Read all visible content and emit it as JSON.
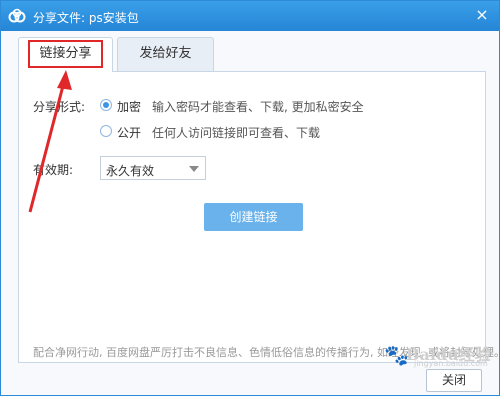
{
  "window": {
    "title": "分享文件: ps安装包",
    "close_glyph": "×"
  },
  "tabs": [
    {
      "label": "链接分享",
      "active": true
    },
    {
      "label": "发给好友",
      "active": false
    }
  ],
  "share_mode": {
    "label": "分享形式:",
    "options": [
      {
        "label": "加密",
        "hint": "输入密码才能查看、下载, 更加私密安全",
        "checked": true
      },
      {
        "label": "公开",
        "hint": "任何人访问链接即可查看、下载",
        "checked": false
      }
    ]
  },
  "validity": {
    "label": "有效期:",
    "selected": "永久有效"
  },
  "create_button": "创建链接",
  "footer_note": "配合净网行动, 百度网盘严厉打击不良信息、色情低俗信息的传播行为, 如经发现, 或将封号处理。",
  "close_button": "关闭",
  "watermark": {
    "text": "Baidu经验",
    "sub": "jingyan.baidu.com"
  },
  "colors": {
    "titlebar": "#2585d6",
    "accent": "#3b97e6",
    "button": "#6ab2ec",
    "annotation": "#e0282a"
  }
}
